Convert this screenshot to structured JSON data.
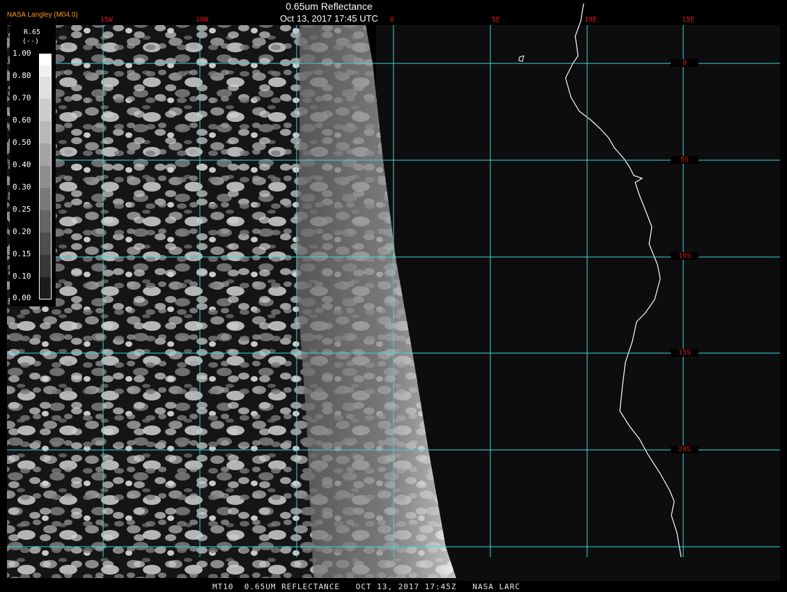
{
  "header": {
    "title": "0.65um Reflectance",
    "timestamp": "Oct 13, 2017 17:45 UTC",
    "brand": "NASA Langley (M04.0)"
  },
  "map": {
    "longitude_labels": [
      "15W",
      "10W",
      "0",
      "5E",
      "10E",
      "15E"
    ],
    "latitude_labels": [
      "0",
      "5S",
      "10S",
      "15S",
      "20S"
    ],
    "colors": {
      "grid": "#3fd6e0",
      "coastline": "#ffffff",
      "label_red": "#e01818",
      "brand_orange": "#ff9a1a"
    }
  },
  "legend": {
    "variable": "R.65",
    "unit": "(--)",
    "ticks": [
      "1.00",
      "0.80",
      "0.70",
      "0.60",
      "0.50",
      "0.40",
      "0.30",
      "0.25",
      "0.20",
      "0.15",
      "0.10",
      "0.00"
    ]
  },
  "footer": {
    "caption": "MT10  0.65UM REFLECTANCE   OCT 13, 2017 17:45Z   NASA LARC"
  }
}
